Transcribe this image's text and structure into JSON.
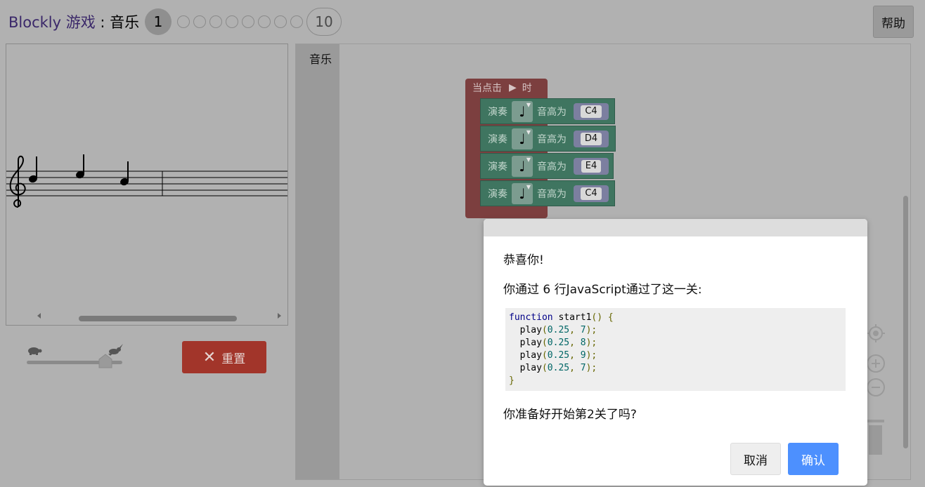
{
  "header": {
    "brand": "Blockly 游戏",
    "separator": " : ",
    "game_name": "音乐",
    "current_level": "1",
    "last_level": "10",
    "help_label": "帮助"
  },
  "controls": {
    "reset_label": "重置",
    "speed_slow_icon": "turtle-icon",
    "speed_fast_icon": "rabbit-icon"
  },
  "toolbox": {
    "category": "音乐"
  },
  "program": {
    "hat": {
      "prefix": "当点击",
      "suffix": "时"
    },
    "blocks": [
      {
        "play_label": "演奏",
        "pitch_label": "音高为",
        "pitch": "C4"
      },
      {
        "play_label": "演奏",
        "pitch_label": "音高为",
        "pitch": "D4"
      },
      {
        "play_label": "演奏",
        "pitch_label": "音高为",
        "pitch": "E4"
      },
      {
        "play_label": "演奏",
        "pitch_label": "音高为",
        "pitch": "C4"
      }
    ]
  },
  "dialog": {
    "congrats": "恭喜你!",
    "summary": "你通过 6 行JavaScript通过了这一关:",
    "code": {
      "header": "function start1() {",
      "lines": [
        "play(0.25, 7);",
        "play(0.25, 8);",
        "play(0.25, 9);",
        "play(0.25, 7);"
      ],
      "footer": "}"
    },
    "question": "你准备好开始第2关了吗?",
    "cancel_label": "取消",
    "ok_label": "确认"
  },
  "colors": {
    "hat_block": "#7c3f3f",
    "music_block": "#3f7560",
    "reset_button": "#a2352a",
    "ok_button": "#4d90fe"
  }
}
